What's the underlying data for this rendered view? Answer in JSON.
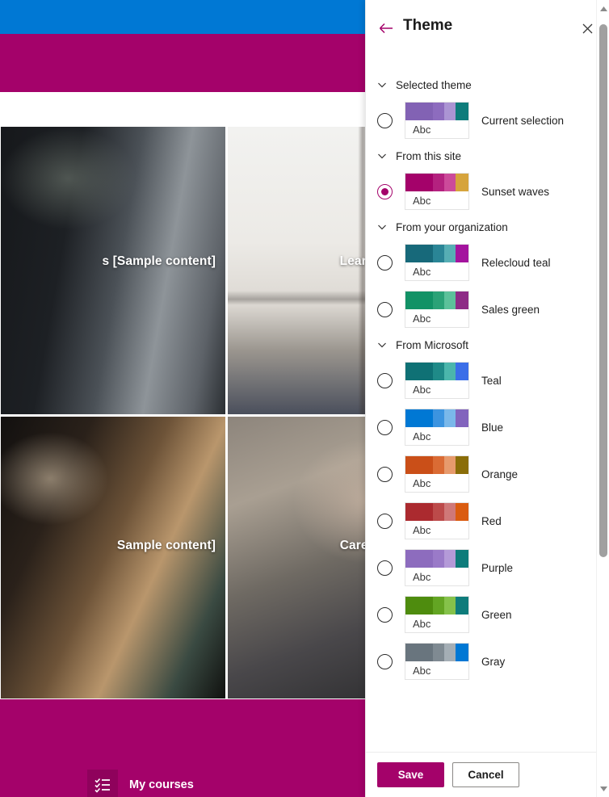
{
  "background": {
    "colors": {
      "topbar": "#0078d4",
      "band": "#a4026a",
      "footer_band": "#a4026a"
    },
    "cards": [
      {
        "title": "s [Sample content]"
      },
      {
        "title": "Learn a new lang"
      },
      {
        "title": "Sample content]"
      },
      {
        "title": "Career developm"
      }
    ],
    "footer_nav": {
      "label": "My courses",
      "icon": "checklist-icon"
    }
  },
  "panel": {
    "title": "Theme",
    "back_icon": "back-arrow-icon",
    "close_icon": "close-icon",
    "accent": "#a4026a",
    "sections": [
      {
        "label": "Selected theme",
        "chevron": "chevron-down-icon",
        "themes": [
          {
            "name": "Current selection",
            "selected": false,
            "sample_text": "Abc",
            "colors": [
              "#8262b4",
              "#8d6cbe",
              "#ab94d3",
              "#0e7c7b"
            ]
          }
        ]
      },
      {
        "label": "From this site",
        "chevron": "chevron-down-icon",
        "themes": [
          {
            "name": "Sunset waves",
            "selected": true,
            "sample_text": "Abc",
            "colors": [
              "#a4026a",
              "#b4217f",
              "#cc4a9a",
              "#d6a43c"
            ]
          }
        ]
      },
      {
        "label": "From your organization",
        "chevron": "chevron-down-icon",
        "themes": [
          {
            "name": "Relecloud teal",
            "selected": false,
            "sample_text": "Abc",
            "colors": [
              "#17697a",
              "#2a8596",
              "#56aeb4",
              "#a4139e"
            ]
          },
          {
            "name": "Sales green",
            "selected": false,
            "sample_text": "Abc",
            "colors": [
              "#129266",
              "#2ba277",
              "#5cc19a",
              "#8e2b86"
            ]
          }
        ]
      },
      {
        "label": "From Microsoft",
        "chevron": "chevron-down-icon",
        "themes": [
          {
            "name": "Teal",
            "selected": false,
            "sample_text": "Abc",
            "colors": [
              "#0f7175",
              "#1f8a88",
              "#4bb6ac",
              "#3a6ee8"
            ]
          },
          {
            "name": "Blue",
            "selected": false,
            "sample_text": "Abc",
            "colors": [
              "#0078d4",
              "#3c94e0",
              "#7ab8ea",
              "#8264bd"
            ]
          },
          {
            "name": "Orange",
            "selected": false,
            "sample_text": "Abc",
            "colors": [
              "#ca4f18",
              "#da6b34",
              "#e79a6c",
              "#8a6d08"
            ]
          },
          {
            "name": "Red",
            "selected": false,
            "sample_text": "Abc",
            "colors": [
              "#ab2a2f",
              "#bc4a4a",
              "#cf7878",
              "#da5c10"
            ]
          },
          {
            "name": "Purple",
            "selected": false,
            "sample_text": "Abc",
            "colors": [
              "#8d6cbe",
              "#9a7ac8",
              "#b49ad8",
              "#0e7c7b"
            ]
          },
          {
            "name": "Green",
            "selected": false,
            "sample_text": "Abc",
            "colors": [
              "#4e8c0e",
              "#63a523",
              "#85c24a",
              "#0e7c7b"
            ]
          },
          {
            "name": "Gray",
            "selected": false,
            "sample_text": "Abc",
            "colors": [
              "#69757e",
              "#7f8a92",
              "#a4aeb5",
              "#0078d4"
            ]
          }
        ]
      }
    ],
    "footer": {
      "save_label": "Save",
      "cancel_label": "Cancel"
    }
  }
}
